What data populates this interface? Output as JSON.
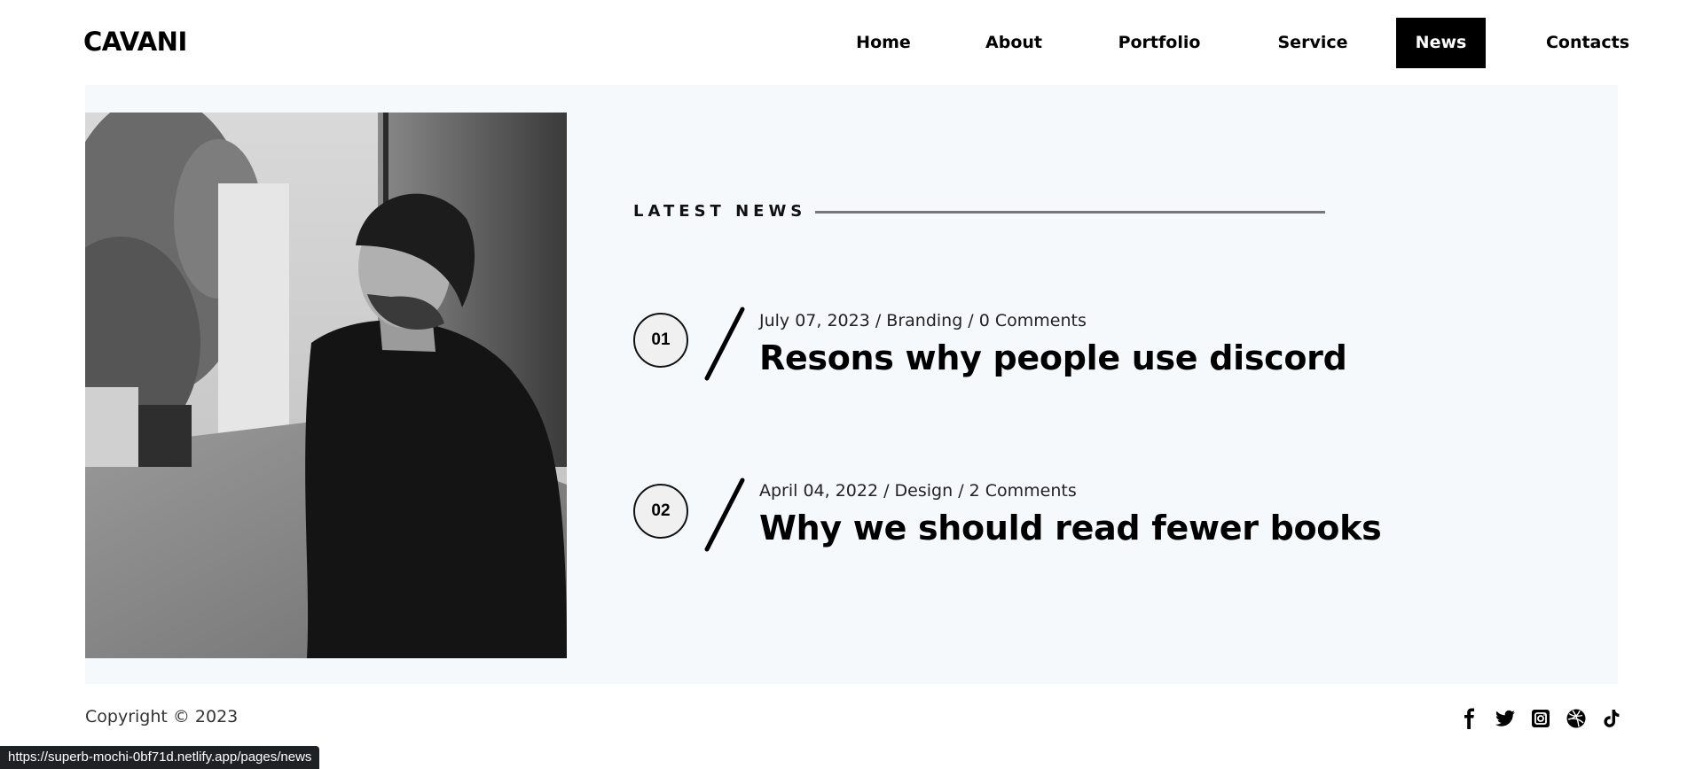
{
  "brand": {
    "logo": "CAVANI"
  },
  "nav": {
    "items": [
      {
        "label": "Home"
      },
      {
        "label": "About"
      },
      {
        "label": "Portfolio"
      },
      {
        "label": "Service"
      },
      {
        "label": "News",
        "active": true
      },
      {
        "label": "Contacts"
      }
    ]
  },
  "news": {
    "heading": "LATEST NEWS",
    "items": [
      {
        "number": "01",
        "meta": "July 07, 2023 / Branding / 0 Comments",
        "title": "Resons why people use discord"
      },
      {
        "number": "02",
        "meta": "April 04, 2022 / Design / 2 Comments",
        "title": "Why we should read fewer books"
      }
    ]
  },
  "footer": {
    "copyright": "Copyright © 2023",
    "socials": [
      "facebook-icon",
      "twitter-icon",
      "instagram-icon",
      "dribbble-icon",
      "tiktok-icon"
    ]
  },
  "status_bar": {
    "url": "https://superb-mochi-0bf71d.netlify.app/pages/news"
  },
  "colors": {
    "panel_bg": "#f5f9fc",
    "accent": "#000000",
    "active_nav_text": "#ffffff"
  }
}
